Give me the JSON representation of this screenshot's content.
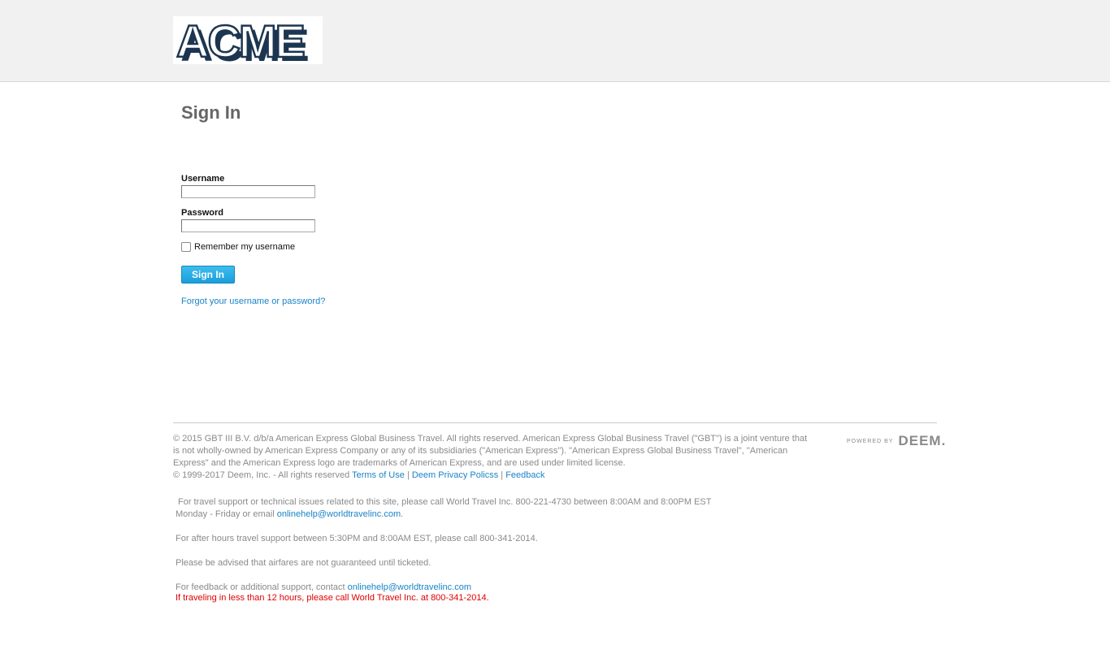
{
  "header": {
    "logo_text": "ACME"
  },
  "signin": {
    "title": "Sign In",
    "username_label": "Username",
    "username_value": "",
    "password_label": "Password",
    "password_value": "",
    "remember_label": "Remember my username",
    "remember_checked": false,
    "button_label": "Sign In",
    "forgot_link": "Forgot your username or password?"
  },
  "footer": {
    "legal_text": "© 2015 GBT III B.V. d/b/a American Express Global Business Travel. All rights reserved. American Express Global Business Travel (\"GBT\") is a joint venture that is not wholly-owned by American Express Company or any of its subsidiaries (\"American Express\"). \"American Express Global Business Travel\", \"American Express\" and the American Express logo are trademarks of American Express, and are used under limited license.",
    "copyright_line": "© 1999-2017 Deem, Inc. - All rights reserved",
    "terms_link": "Terms of Use",
    "privacy_link": "Deem Privacy Policss",
    "feedback_link": "Feedback",
    "separator": "|",
    "powered_by_label": "POWERED BY",
    "powered_by_brand": "DEEM."
  },
  "support": {
    "line1": "For travel support or technical issues related to this site, please call World Travel Inc. 800-221-4730 between 8:00AM and 8:00PM EST",
    "line2_prefix": "Monday - Friday or email",
    "line2_email": "onlinehelp@worldtravelinc.com",
    "line2_suffix": ".",
    "after_hours": "For after hours travel support between 5:30PM and 8:00AM EST, please call 800-341-2014.",
    "airfare_notice": "Please be advised that airfares are not guaranteed until ticketed.",
    "feedback_prefix": "For feedback or additional support, contact",
    "feedback_email": "onlinehelp@worldtravelinc.com",
    "urgent_notice": "If traveling in less than 12 hours, please call World Travel Inc. at 800-341-2014."
  },
  "colors": {
    "link": "#1a84c6",
    "button": "#1a9fdb",
    "warning": "#e00000",
    "header_bg": "#f1f1f1"
  }
}
